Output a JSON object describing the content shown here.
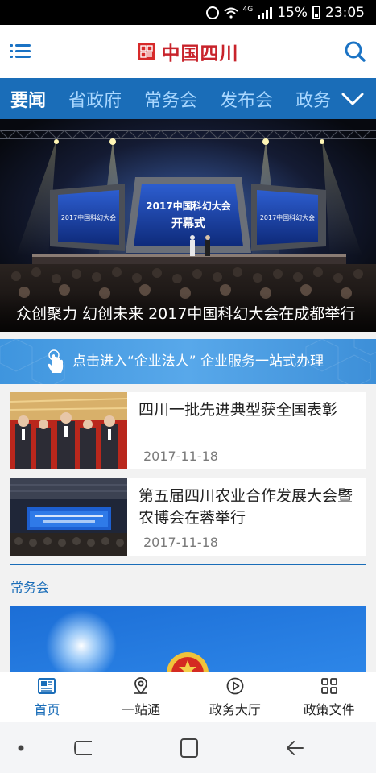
{
  "status_bar": {
    "network": "4G",
    "battery": "15%",
    "time": "23:05"
  },
  "header": {
    "logo_seal": "中国四川",
    "title": "中国四川"
  },
  "tabs": [
    {
      "label": "要闻",
      "active": true
    },
    {
      "label": "省政府",
      "active": false
    },
    {
      "label": "常务会",
      "active": false
    },
    {
      "label": "发布会",
      "active": false
    },
    {
      "label": "政务",
      "active": false
    }
  ],
  "hero": {
    "caption": "众创聚力 幻创未来 2017中国科幻大会在成都举行",
    "screen_text_1": "2017中国科幻大会",
    "screen_text_2": "开幕式",
    "side_screen_text": "2017中国科幻大会"
  },
  "banner": {
    "text": "点击进入“企业法人” 企业服务一站式办理"
  },
  "news": [
    {
      "title": "四川一批先进典型获全国表彰",
      "date": "2017-11-18"
    },
    {
      "title": "第五届四川农业合作发展大会暨农博会在蓉举行",
      "date": "2017-11-18"
    }
  ],
  "section": {
    "title": "常务会"
  },
  "bottom_nav": [
    {
      "label": "首页",
      "icon": "newspaper-icon",
      "active": true
    },
    {
      "label": "一站通",
      "icon": "location-pin-icon",
      "active": false
    },
    {
      "label": "政务大厅",
      "icon": "play-circle-icon",
      "active": false
    },
    {
      "label": "政策文件",
      "icon": "grid-icon",
      "active": false
    }
  ],
  "colors": {
    "brand_blue": "#1a6db8",
    "logo_red": "#c8232b",
    "tab_inactive": "#a9d7ff"
  }
}
